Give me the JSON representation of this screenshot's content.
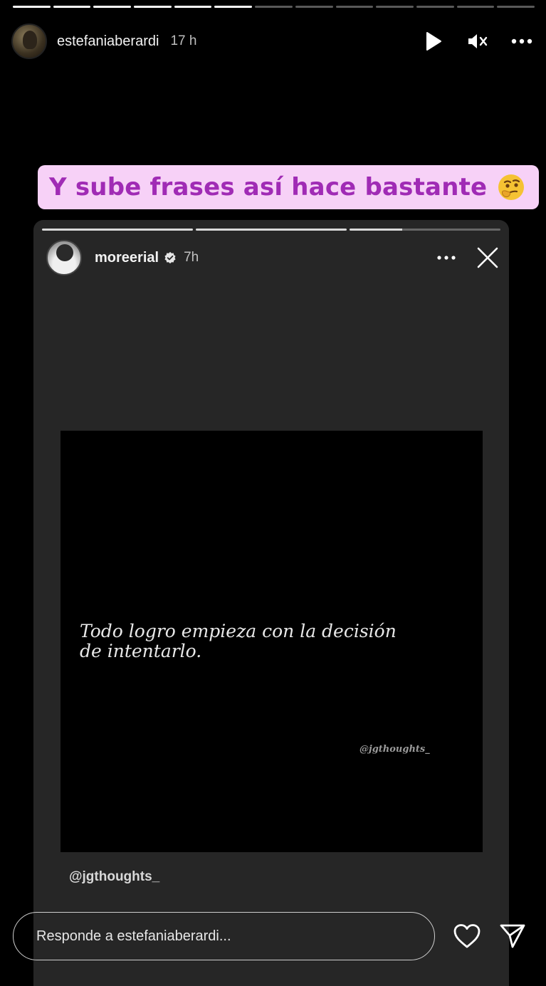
{
  "story": {
    "progress_total": 13,
    "progress_complete": 6,
    "header": {
      "username": "estefaniaberardi",
      "time": "17 h",
      "play_icon": "play-icon",
      "mute_icon": "muted-speaker-icon",
      "more_icon": "more-horizontal-icon"
    },
    "sticker": {
      "text": "Y sube frases así hace bastante",
      "emoji": "thinking-face-emoji",
      "background": "#f7d1f7",
      "text_color": "#a02bb5"
    },
    "embedded": {
      "progress_total": 3,
      "progress_values": [
        1,
        1,
        0.35
      ],
      "username": "moreerial",
      "verified_icon": "verified-badge-icon",
      "time": "7h",
      "more_icon": "more-horizontal-icon",
      "close_icon": "close-icon",
      "post": {
        "quote_line1": "Todo logro empieza con la decisión",
        "quote_line2": "de intentarlo.",
        "watermark": "@jgthoughts_"
      },
      "mention": "@jgthoughts_"
    },
    "reply": {
      "placeholder": "Responde a estefaniaberardi...",
      "heart_icon": "heart-icon",
      "send_icon": "send-icon"
    }
  }
}
